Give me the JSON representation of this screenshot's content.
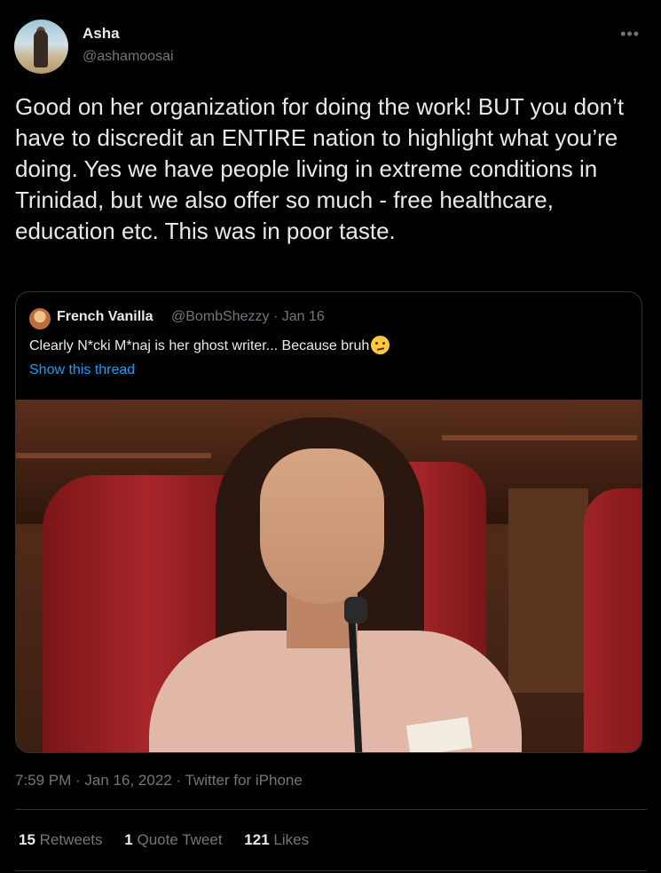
{
  "author": {
    "name": "Asha",
    "handle": "@ashamoosai",
    "avatar_icon": "profile-photo"
  },
  "more_icon": "more-horizontal-icon",
  "tweet_text": "Good on her organization for doing the work! BUT you don’t have to discredit an ENTIRE nation to highlight what you’re doing. Yes we have people living in extreme conditions in Trinidad, but we also offer so much - free healthcare, education etc. This was in poor taste.",
  "quoted": {
    "name": "French Vanilla",
    "meta": "@BombShezzy · Jan 16",
    "text": "Clearly N*cki M*naj is her ghost writer... Because bruh",
    "emoji": "confused-face-icon",
    "show_thread": "Show this thread"
  },
  "timestamp": "7:59 PM · Jan 16, 2022 · Twitter for iPhone",
  "stats": {
    "retweets_count": "15",
    "retweets_label": "Retweets",
    "quotes_count": "1",
    "quotes_label": "Quote Tweet",
    "likes_count": "121",
    "likes_label": "Likes"
  },
  "colors": {
    "background": "#000000",
    "text": "#e7e9ea",
    "secondary": "#71767b",
    "link": "#1d9bf0",
    "border": "#2f3336"
  }
}
